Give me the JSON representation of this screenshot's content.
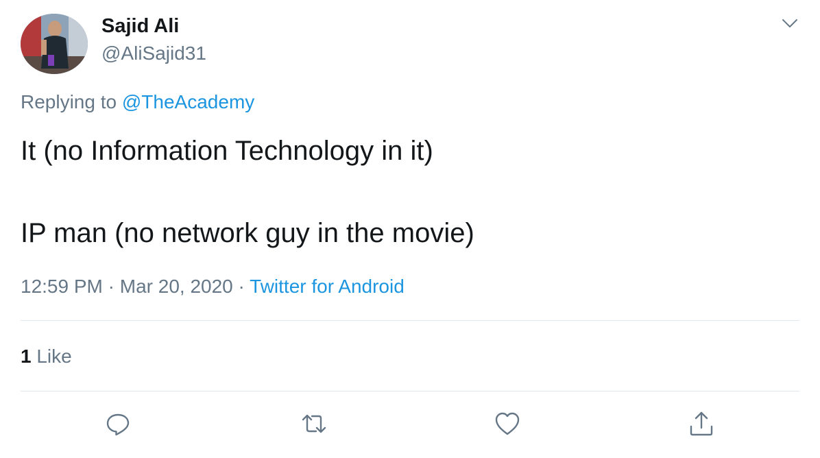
{
  "author": {
    "display_name": "Sajid Ali",
    "handle": "@AliSajid31"
  },
  "reply_context": {
    "prefix": "Replying to",
    "mention": "@TheAcademy"
  },
  "tweet": {
    "line1": "It (no Information Technology in it)",
    "line2": "IP man (no network guy in the movie)"
  },
  "meta": {
    "time": "12:59 PM",
    "separator": "·",
    "date": "Mar 20, 2020",
    "source": "Twitter for Android"
  },
  "stats": {
    "like_count": "1",
    "like_label": "Like"
  },
  "actions": {
    "reply_icon": "reply-icon",
    "retweet_icon": "retweet-icon",
    "like_icon": "heart-icon",
    "share_icon": "share-icon"
  },
  "colors": {
    "link": "#1b95e0",
    "secondary_text": "#657786",
    "primary_text": "#14171a",
    "divider": "#e1e8ed"
  }
}
